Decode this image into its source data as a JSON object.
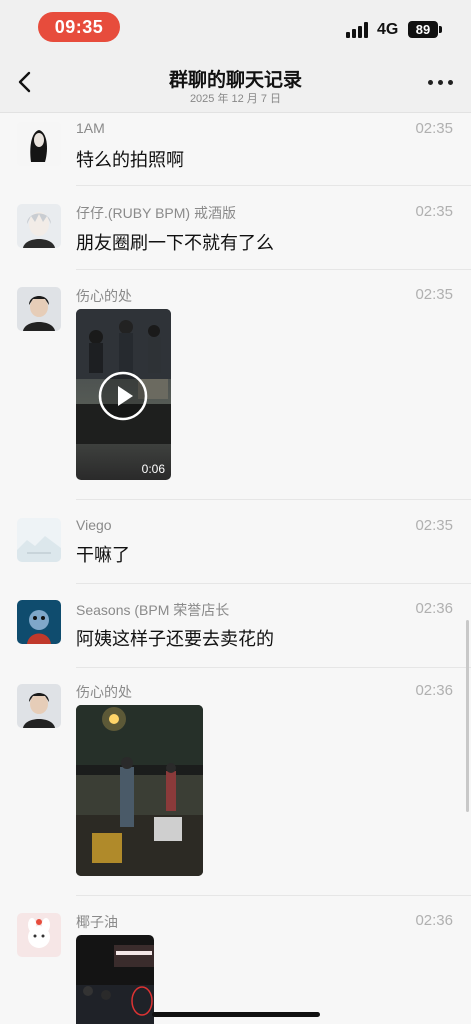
{
  "status": {
    "time": "09:35",
    "network": "4G",
    "battery": "89"
  },
  "nav": {
    "title": "群聊的聊天记录",
    "subtitle": "2025 年 12 月 7 日",
    "back_icon": "chevron-left-icon",
    "more_icon": "more-icon"
  },
  "messages": [
    {
      "name": "1AM",
      "time": "02:35",
      "text": "特么的拍照啊"
    },
    {
      "name": "仔仔.(RUBY BPM) 戒酒版",
      "time": "02:35",
      "text": "朋友圈刷一下不就有了么"
    },
    {
      "name": "伤心的处",
      "time": "02:35",
      "video_duration": "0:06"
    },
    {
      "name": "Viego",
      "time": "02:35",
      "text": "干嘛了"
    },
    {
      "name": "Seasons (BPM 荣誉店长",
      "time": "02:36",
      "text": "阿姨这样子还要去卖花的"
    },
    {
      "name": "伤心的处",
      "time": "02:36"
    },
    {
      "name": "椰子油",
      "time": "02:36"
    }
  ]
}
